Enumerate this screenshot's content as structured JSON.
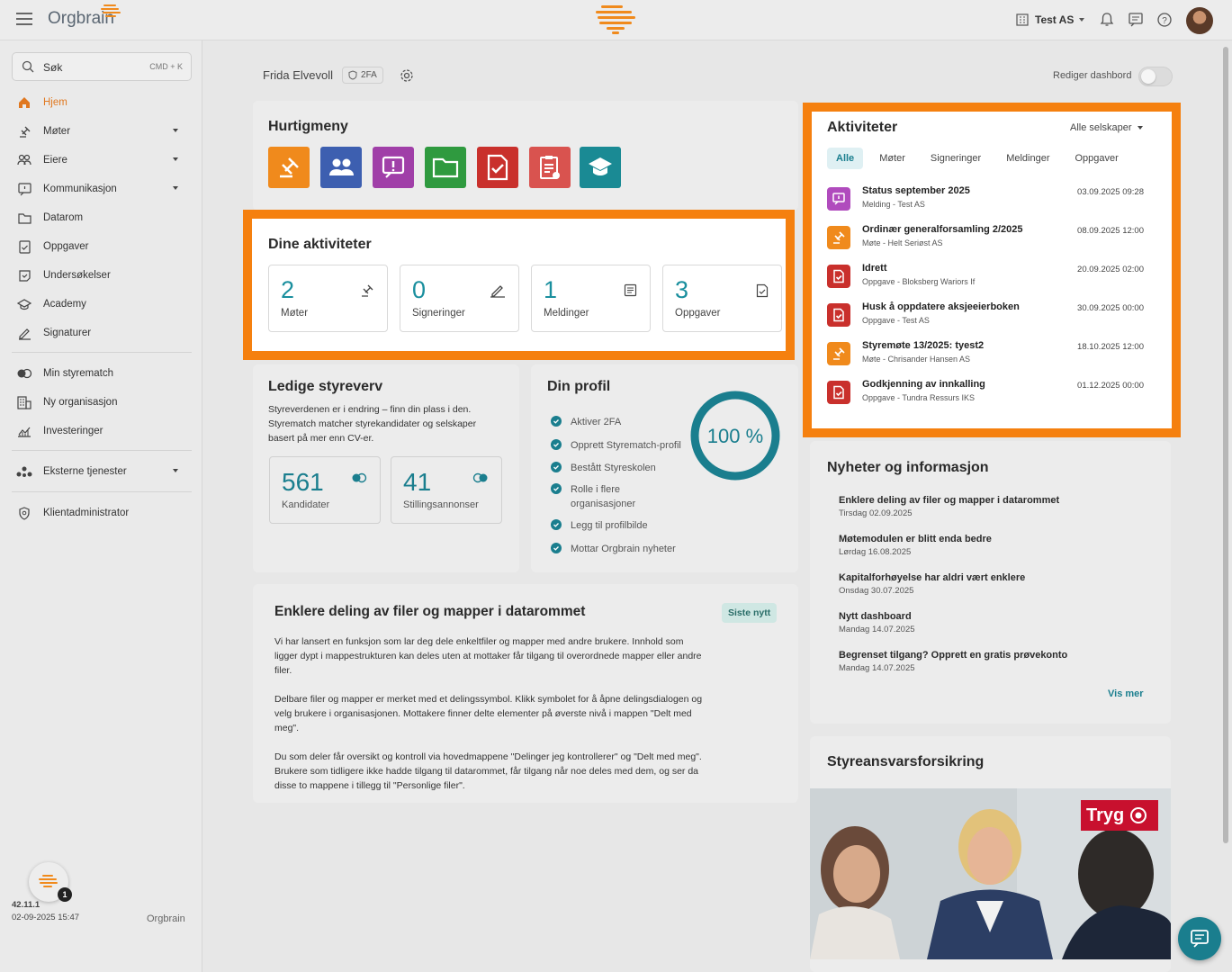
{
  "app": {
    "brand": "Orgbrain",
    "company": "Test AS",
    "version": "42.11.1",
    "build_time": "02-09-2025 15:47",
    "help_badge": "1"
  },
  "search": {
    "label": "Søk",
    "shortcut": "CMD + K"
  },
  "sidebar": {
    "items": [
      {
        "label": "Hjem",
        "icon": "home-icon"
      },
      {
        "label": "Møter",
        "icon": "gavel-icon"
      },
      {
        "label": "Eiere",
        "icon": "people-icon"
      },
      {
        "label": "Kommunikasjon",
        "icon": "message-icon"
      },
      {
        "label": "Datarom",
        "icon": "folder-icon"
      },
      {
        "label": "Oppgaver",
        "icon": "task-icon"
      },
      {
        "label": "Undersøkelser",
        "icon": "survey-icon"
      },
      {
        "label": "Academy",
        "icon": "academy-icon"
      },
      {
        "label": "Signaturer",
        "icon": "signature-icon"
      },
      {
        "label": "Min styrematch",
        "icon": "match-icon"
      },
      {
        "label": "Ny organisasjon",
        "icon": "building-icon"
      },
      {
        "label": "Investeringer",
        "icon": "chart-icon"
      },
      {
        "label": "Eksterne tjenester",
        "icon": "services-icon"
      },
      {
        "label": "Klientadministrator",
        "icon": "shield-icon"
      }
    ]
  },
  "header": {
    "user_name": "Frida Elvevoll",
    "twofa": "2FA",
    "edit_dashboard": "Rediger dashbord"
  },
  "quickmenu": {
    "title": "Hurtigmeny",
    "tiles": [
      {
        "icon": "gavel-icon",
        "color": "#f08a1c"
      },
      {
        "icon": "people-icon",
        "color": "#3d5fb0"
      },
      {
        "icon": "message-icon",
        "color": "#a03fa8"
      },
      {
        "icon": "folder-icon",
        "color": "#2f9a3f"
      },
      {
        "icon": "task-icon",
        "color": "#c9302c"
      },
      {
        "icon": "survey-icon",
        "color": "#d9534f"
      },
      {
        "icon": "academy-icon",
        "color": "#1a8a94"
      }
    ]
  },
  "my_activities": {
    "title": "Dine aktiviteter",
    "boxes": [
      {
        "count": "2",
        "label": "Møter"
      },
      {
        "count": "0",
        "label": "Signeringer"
      },
      {
        "count": "1",
        "label": "Meldinger"
      },
      {
        "count": "3",
        "label": "Oppgaver"
      }
    ]
  },
  "activities": {
    "title": "Aktiviteter",
    "filter": "Alle selskaper",
    "tabs": [
      "Alle",
      "Møter",
      "Signeringer",
      "Meldinger",
      "Oppgaver"
    ],
    "items": [
      {
        "title": "Status september 2025",
        "sub": "Melding - Test AS",
        "date": "03.09.2025 09:28",
        "color": "#b04bbd",
        "icon": "message-icon"
      },
      {
        "title": "Ordinær generalforsamling 2/2025",
        "sub": "Møte - Helt Seriøst AS",
        "date": "08.09.2025 12:00",
        "color": "#f08a1c",
        "icon": "gavel-icon"
      },
      {
        "title": "Idrett",
        "sub": "Oppgave - Bloksberg Wariors If",
        "date": "20.09.2025 02:00",
        "color": "#c9302c",
        "icon": "task-icon"
      },
      {
        "title": "Husk å oppdatere aksjeeierboken",
        "sub": "Oppgave - Test AS",
        "date": "30.09.2025 00:00",
        "color": "#c9302c",
        "icon": "task-icon"
      },
      {
        "title": "Styremøte 13/2025: tyest2",
        "sub": "Møte - Chrisander Hansen AS",
        "date": "18.10.2025 12:00",
        "color": "#f08a1c",
        "icon": "gavel-icon"
      },
      {
        "title": "Godkjenning av innkalling",
        "sub": "Oppgave - Tundra Ressurs IKS",
        "date": "01.12.2025 00:00",
        "color": "#c9302c",
        "icon": "task-icon"
      }
    ]
  },
  "board": {
    "title": "Ledige styreverv",
    "text": "Styreverdenen er i endring – finn din plass i den. Styrematch matcher styrekandidater og selskaper basert på mer enn CV-er.",
    "stats": [
      {
        "count": "561",
        "label": "Kandidater"
      },
      {
        "count": "41",
        "label": "Stillingsannonser"
      }
    ]
  },
  "profile": {
    "title": "Din profil",
    "progress_label": "100 %",
    "progress": 1.0,
    "items": [
      "Aktiver 2FA",
      "Opprett Styrematch-profil",
      "Bestått Styreskolen",
      "Rolle i flere organisasjoner",
      "Legg til profilbilde",
      "Mottar Orgbrain nyheter"
    ]
  },
  "news": {
    "title": "Nyheter og informasjon",
    "items": [
      {
        "title": "Enklere deling av filer og mapper i datarommet",
        "date": "Tirsdag 02.09.2025"
      },
      {
        "title": "Møtemodulen er blitt enda bedre",
        "date": "Lørdag 16.08.2025"
      },
      {
        "title": "Kapitalforhøyelse har aldri vært enklere",
        "date": "Onsdag 30.07.2025"
      },
      {
        "title": "Nytt dashboard",
        "date": "Mandag 14.07.2025"
      },
      {
        "title": "Begrenset tilgang? Opprett en gratis prøvekonto",
        "date": "Mandag 14.07.2025"
      }
    ],
    "more": "Vis mer"
  },
  "article": {
    "title": "Enklere deling av filer og mapper i datarommet",
    "badge": "Siste nytt",
    "p1": "Vi har lansert en funksjon som lar deg dele enkeltfiler og mapper med andre brukere. Innhold som ligger dypt i mappestrukturen kan deles uten at mottaker får tilgang til overordnede mapper eller andre filer.",
    "p2": "Delbare filer og mapper er merket med et delingssymbol. Klikk symbolet for å åpne delingsdialogen og velg brukere i organisasjonen. Mottakere finner delte elementer på øverste nivå i mappen \"Delt med meg\".",
    "p3": "Du som deler får oversikt og kontroll via hovedmappene \"Delinger jeg kontrollerer\" og \"Delt med meg\". Brukere som tidligere ikke hadde tilgang til datarommet, får tilgang når noe deles med dem, og ser da disse to mappene i tillegg til \"Personlige filer\"."
  },
  "insurance": {
    "title": "Styreansvarsforsikring",
    "brand": "Tryg"
  }
}
